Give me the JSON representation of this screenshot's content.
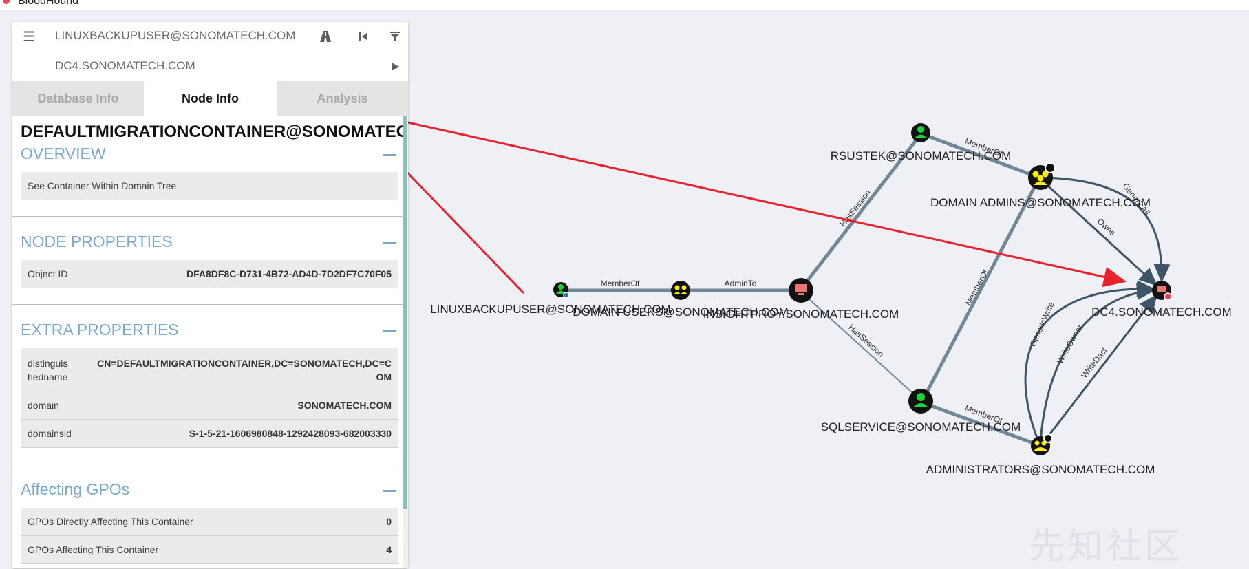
{
  "window": {
    "title": "BloodHound"
  },
  "panel": {
    "search": {
      "start_node": "LINUXBACKUPUSER@SONOMATECH.COM",
      "target_node": "DC4.SONOMATECH.COM"
    },
    "tabs": [
      {
        "label": "Database Info",
        "active": false
      },
      {
        "label": "Node Info",
        "active": true
      },
      {
        "label": "Analysis",
        "active": false
      }
    ],
    "node_title": "DEFAULTMIGRATIONCONTAINER@SONOMATECH.COM",
    "overview": {
      "heading": "OVERVIEW",
      "link": "See Container Within Domain Tree"
    },
    "node_properties": {
      "heading": "NODE PROPERTIES",
      "rows": [
        {
          "key": "Object ID",
          "value": "DFA8DF8C-D731-4B72-AD4D-7D2DF7C70F05"
        }
      ]
    },
    "extra_properties": {
      "heading": "EXTRA PROPERTIES",
      "rows": [
        {
          "key": "distinguis hedname",
          "value": "CN=DEFAULTMIGRATIONCONTAINER,DC=SONOMATECH,DC=COM"
        },
        {
          "key": "domain",
          "value": "SONOMATECH.COM"
        },
        {
          "key": "domainsid",
          "value": "S-1-5-21-1606980848-1292428093-682003330"
        }
      ]
    },
    "affecting_gpos": {
      "heading": "Affecting GPOs",
      "rows": [
        {
          "key": "GPOs Directly Affecting This Container",
          "value": "0"
        },
        {
          "key": "GPOs Affecting This Container",
          "value": "4"
        }
      ]
    }
  },
  "graph": {
    "nodes": {
      "linuxbackupuser": "LINUXBACKUPUSER@SONOMATECH.COM",
      "domain_users": "DOMAIN USERS@SONOMATECH.COM",
      "insightproy": "INSIGHTPROY.SONOMATECH.COM",
      "rsustek": "RSUSTEK@SONOMATECH.COM",
      "domain_admins": "DOMAIN ADMINS@SONOMATECH.COM",
      "sqlservice": "SQLSERVICE@SONOMATECH.COM",
      "administrators": "ADMINISTRATORS@SONOMATECH.COM",
      "dc4": "DC4.SONOMATECH.COM"
    },
    "edges": {
      "memberof": "MemberOf",
      "adminto": "AdminTo",
      "hassession": "HasSession",
      "genericall": "GenericAll",
      "owns": "Owns",
      "genericwrite": "GenericWrite",
      "writeowner": "WriteOwner",
      "writedacl": "WriteDacl"
    },
    "colors": {
      "user_node": "#17d635",
      "group_node": "#ffee00",
      "computer_node": "#e67873",
      "edge": "#6f8797",
      "annotation_arrow": "#e8222d"
    }
  },
  "watermark": "先知社区"
}
